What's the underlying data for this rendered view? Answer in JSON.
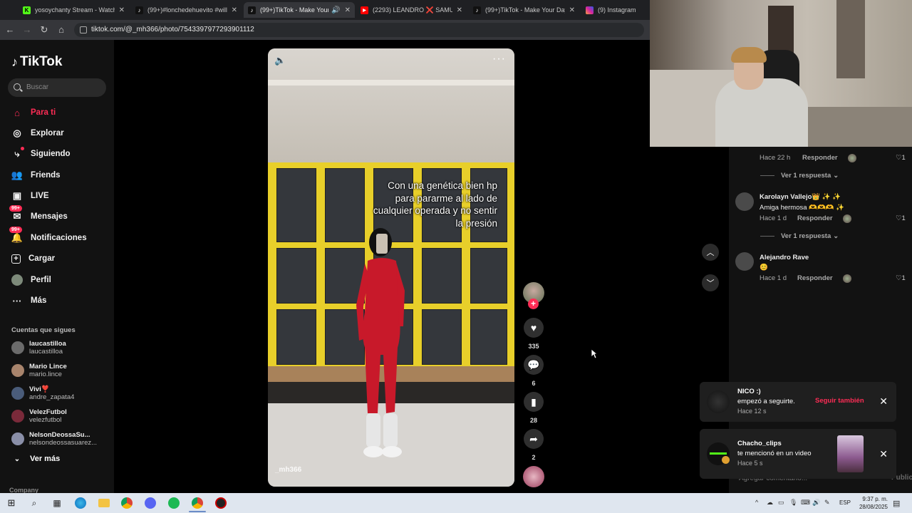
{
  "browser": {
    "tabs": [
      {
        "label": "yosoychanty Stream - Watch Li",
        "icon": "kick-icon",
        "color": "#53fc18"
      },
      {
        "label": "(99+)#lonchedehuevito #willito",
        "icon": "tiktok-icon",
        "color": "#000000"
      },
      {
        "label": "(99+)TikTok - Make Your Da",
        "icon": "tiktok-icon",
        "color": "#000000"
      },
      {
        "label": "(2293) LEANDRO ❌ SAMU",
        "icon": "youtube-icon",
        "color": "#ff0000"
      },
      {
        "label": "(99+)TikTok - Make Your Day",
        "icon": "tiktok-icon",
        "color": "#000000"
      },
      {
        "label": "(9) Instagram",
        "icon": "instagram-icon",
        "color": "#d6249f"
      }
    ],
    "url": "tiktok.com/@_mh366/photo/7543397977293901112"
  },
  "sidebar": {
    "logo": "TikTok",
    "search_placeholder": "Buscar",
    "nav": [
      {
        "label": "Para ti",
        "icon": "home-icon"
      },
      {
        "label": "Explorar",
        "icon": "compass-icon"
      },
      {
        "label": "Siguiendo",
        "icon": "following-icon"
      },
      {
        "label": "Friends",
        "icon": "friends-icon"
      },
      {
        "label": "LIVE",
        "icon": "live-icon"
      },
      {
        "label": "Mensajes",
        "icon": "messages-icon",
        "badge": "99+"
      },
      {
        "label": "Notificaciones",
        "icon": "notifications-icon",
        "badge": "99+"
      },
      {
        "label": "Cargar",
        "icon": "upload-icon"
      },
      {
        "label": "Perfil",
        "icon": "profile-icon"
      },
      {
        "label": "Más",
        "icon": "more-icon"
      }
    ],
    "following_title": "Cuentas que sigues",
    "accounts": [
      {
        "name": "laucastilloa",
        "handle": "laucastilloa"
      },
      {
        "name": "Mario Lince",
        "handle": "mario.lince"
      },
      {
        "name": "Vivi❣️",
        "handle": "andre_zapata4"
      },
      {
        "name": "VelezFutbol",
        "handle": "velezfutbol"
      },
      {
        "name": "NelsonDeossaSu...",
        "handle": "nelsondeossasuarez..."
      }
    ],
    "see_more": "Ver más",
    "company": "Company"
  },
  "post": {
    "caption": "Con una genética bien hp para pararme al lado de cualquier operada y no sentir la presión",
    "watermark": "_mh366",
    "likes": "335",
    "comments": "6",
    "saves": "28",
    "shares": "2"
  },
  "comments": {
    "items": [
      {
        "name": "",
        "text": "",
        "time": "Hace 22 h",
        "reply": "Responder",
        "likes": "1",
        "view_replies": "Ver 1 respuesta"
      },
      {
        "name": "Karolayn Vallejo👑 ✨ ✨",
        "text": "Amiga hermosa 🫶🫶🫶 ✨",
        "time": "Hace 1 d",
        "reply": "Responder",
        "likes": "1",
        "view_replies": "Ver 1 respuesta"
      },
      {
        "name": "Alejandro Rave",
        "text": "😊",
        "time": "Hace 1 d",
        "reply": "Responder",
        "likes": "1"
      }
    ],
    "input_placeholder": "Agregar comentario...",
    "post_label": "Publicar"
  },
  "notifications": [
    {
      "name": "NICO :)",
      "message": "empezó a seguirte.",
      "time": "Hace 12 s",
      "action": "Seguir también"
    },
    {
      "name": "Chacho_clips",
      "message": "te mencionó en un video",
      "time": "Hace 5 s"
    }
  ],
  "taskbar": {
    "language": "ESP",
    "time": "9:37 p. m.",
    "date": "28/08/2025"
  }
}
